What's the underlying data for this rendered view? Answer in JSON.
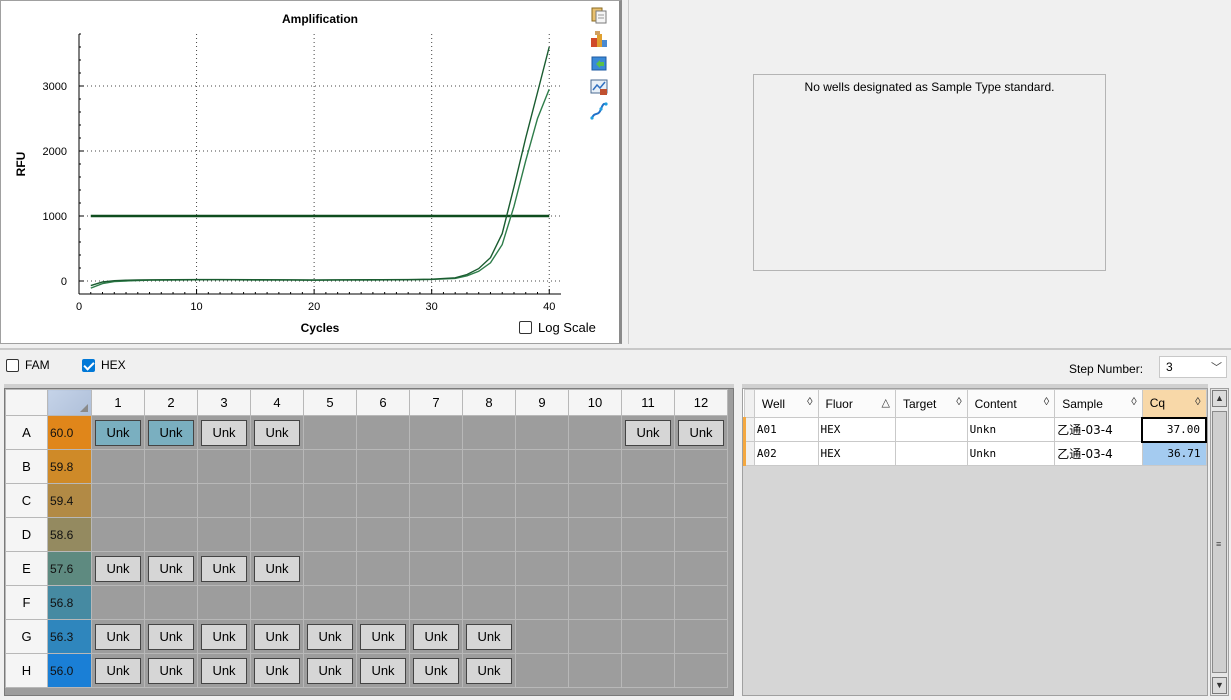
{
  "chart": {
    "icons": [
      "copy-icon",
      "export-icon",
      "refresh-icon",
      "chart-settings-icon",
      "curve-fit-icon"
    ],
    "log_scale_label": "Log Scale",
    "log_scale_checked": false,
    "chart_data": {
      "type": "line",
      "title": "Amplification",
      "xlabel": "Cycles",
      "ylabel": "RFU",
      "xlim": [
        0,
        41
      ],
      "ylim": [
        -200,
        3800
      ],
      "xticks": [
        0,
        10,
        20,
        30,
        40
      ],
      "yticks": [
        0,
        1000,
        2000,
        3000
      ],
      "grid": true,
      "threshold": 1000,
      "series": [
        {
          "color": "#2e7d4a",
          "x": [
            1,
            2,
            3,
            4,
            5,
            6,
            8,
            10,
            12,
            15,
            18,
            20,
            22,
            25,
            28,
            30,
            32,
            33,
            34,
            35,
            36,
            37,
            38,
            39,
            40
          ],
          "y": [
            -110,
            -40,
            -10,
            0,
            8,
            12,
            15,
            18,
            20,
            16,
            14,
            12,
            14,
            16,
            18,
            24,
            40,
            80,
            150,
            280,
            560,
            1150,
            1850,
            2500,
            2950
          ]
        },
        {
          "color": "#1a5c30",
          "x": [
            1,
            2,
            3,
            4,
            5,
            6,
            8,
            10,
            12,
            15,
            18,
            20,
            22,
            25,
            28,
            30,
            32,
            33,
            34,
            35,
            36,
            37,
            38,
            39,
            40
          ],
          "y": [
            -70,
            -15,
            5,
            12,
            15,
            18,
            20,
            22,
            22,
            20,
            18,
            16,
            18,
            20,
            22,
            28,
            50,
            100,
            190,
            360,
            730,
            1450,
            2200,
            2900,
            3600
          ]
        }
      ]
    }
  },
  "std_curve": {
    "message": "No wells designated as Sample Type standard."
  },
  "fluor_bar": {
    "fam_label": "FAM",
    "fam_checked": false,
    "hex_label": "HEX",
    "hex_checked": true,
    "step_label": "Step Number:",
    "step_value": "3"
  },
  "plate": {
    "columns": [
      "1",
      "2",
      "3",
      "4",
      "5",
      "6",
      "7",
      "8",
      "9",
      "10",
      "11",
      "12"
    ],
    "rows": [
      {
        "label": "A",
        "temp": "60.0",
        "temp_color": "#e0861a",
        "wells": [
          "Unk*",
          "Unk*",
          "Unk",
          "Unk",
          "",
          "",
          "",
          "",
          "",
          "",
          "Unk",
          "Unk"
        ]
      },
      {
        "label": "B",
        "temp": "59.8",
        "temp_color": "#cf8a28",
        "wells": [
          "",
          "",
          "",
          "",
          "",
          "",
          "",
          "",
          "",
          "",
          "",
          ""
        ]
      },
      {
        "label": "C",
        "temp": "59.4",
        "temp_color": "#b28a45",
        "wells": [
          "",
          "",
          "",
          "",
          "",
          "",
          "",
          "",
          "",
          "",
          "",
          ""
        ]
      },
      {
        "label": "D",
        "temp": "58.6",
        "temp_color": "#948a60",
        "wells": [
          "",
          "",
          "",
          "",
          "",
          "",
          "",
          "",
          "",
          "",
          "",
          ""
        ]
      },
      {
        "label": "E",
        "temp": "57.6",
        "temp_color": "#5e8a80",
        "wells": [
          "Unk",
          "Unk",
          "Unk",
          "Unk",
          "",
          "",
          "",
          "",
          "",
          "",
          "",
          ""
        ]
      },
      {
        "label": "F",
        "temp": "56.8",
        "temp_color": "#468aa2",
        "wells": [
          "",
          "",
          "",
          "",
          "",
          "",
          "",
          "",
          "",
          "",
          "",
          ""
        ]
      },
      {
        "label": "G",
        "temp": "56.3",
        "temp_color": "#2f86bd",
        "wells": [
          "Unk",
          "Unk",
          "Unk",
          "Unk",
          "Unk",
          "Unk",
          "Unk",
          "Unk",
          "",
          "",
          "",
          ""
        ]
      },
      {
        "label": "H",
        "temp": "56.0",
        "temp_color": "#1a7fd6",
        "wells": [
          "Unk",
          "Unk",
          "Unk",
          "Unk",
          "Unk",
          "Unk",
          "Unk",
          "Unk",
          "",
          "",
          "",
          ""
        ]
      }
    ]
  },
  "results": {
    "headers": [
      {
        "label": "Well",
        "sort": "◊"
      },
      {
        "label": "Fluor",
        "sort": "△"
      },
      {
        "label": "Target",
        "sort": "◊"
      },
      {
        "label": "Content",
        "sort": "◊"
      },
      {
        "label": "Sample",
        "sort": "◊"
      },
      {
        "label": "Cq",
        "sort": "◊"
      }
    ],
    "rows": [
      {
        "well": "A01",
        "fluor": "HEX",
        "target": "",
        "content": "Unkn",
        "sample": "乙通-03-4",
        "cq": "37.00"
      },
      {
        "well": "A02",
        "fluor": "HEX",
        "target": "",
        "content": "Unkn",
        "sample": "乙通-03-4",
        "cq": "36.71"
      }
    ]
  }
}
